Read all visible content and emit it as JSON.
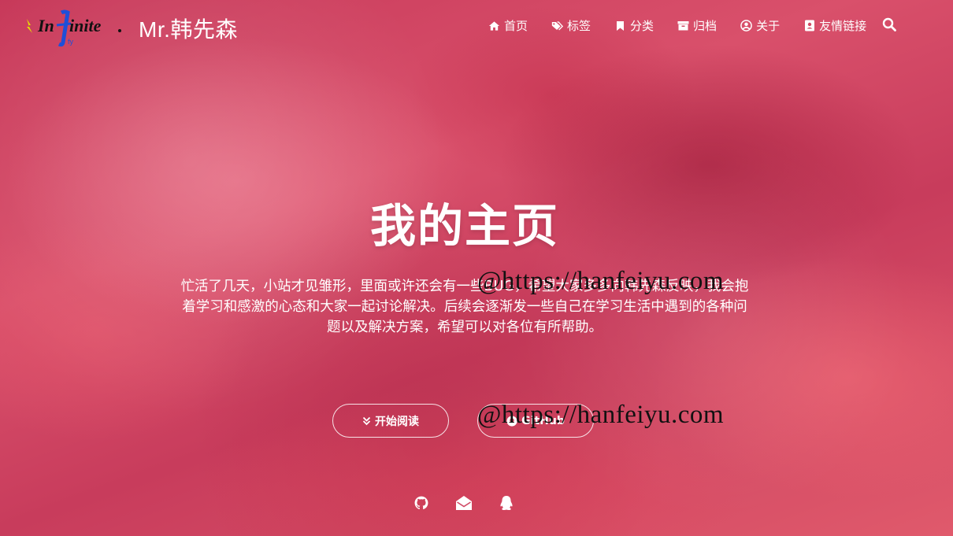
{
  "site": {
    "logo_text": "Infinite.",
    "name": "Mr.韩先森"
  },
  "nav": {
    "items": [
      {
        "label": "首页",
        "icon": "home-icon"
      },
      {
        "label": "标签",
        "icon": "tags-icon"
      },
      {
        "label": "分类",
        "icon": "bookmark-icon"
      },
      {
        "label": "归档",
        "icon": "archive-icon"
      },
      {
        "label": "关于",
        "icon": "user-circle-icon"
      },
      {
        "label": "友情链接",
        "icon": "address-book-icon"
      }
    ],
    "search_icon": "search-icon"
  },
  "hero": {
    "title": "我的主页",
    "description": "忙活了几天，小站才见雏形，里面或许还会有一些BUG，希望大家多多向韩先森反映，我会抱着学习和感激的心态和大家一起讨论解决。后续会逐渐发一些自己在学习生活中遇到的各种问题以及解决方案，希望可以对各位有所帮助。",
    "watermark": "@https://hanfeiyu.com",
    "buttons": [
      {
        "label": "开始阅读",
        "icon": "chevron-double-down-icon"
      },
      {
        "label": "GitHub",
        "icon": "github-icon"
      }
    ]
  },
  "social": [
    "github-icon",
    "envelope-open-icon",
    "qq-icon"
  ],
  "colors": {
    "background": "#d14a65",
    "text": "#ffffff",
    "watermark": "#111111"
  }
}
